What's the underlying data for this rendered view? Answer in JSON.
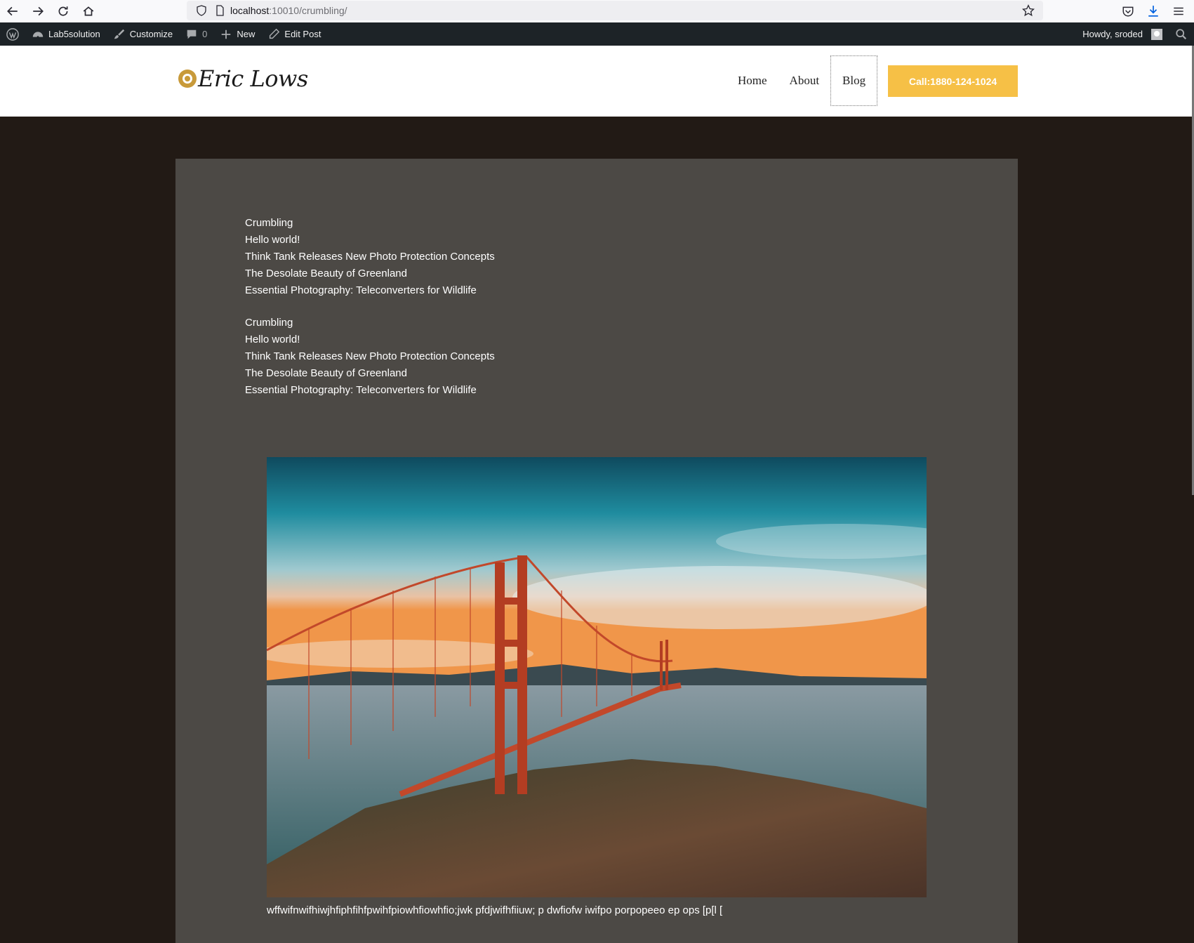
{
  "browser": {
    "url_host": "localhost",
    "url_path": ":10010/crumbling/"
  },
  "adminbar": {
    "site_name": "Lab5solution",
    "customize": "Customize",
    "comments_count": "0",
    "new_label": "New",
    "edit_post": "Edit Post",
    "howdy": "Howdy, sroded"
  },
  "header": {
    "logo_text": "Eric Lows",
    "nav": [
      "Home",
      "About",
      "Blog"
    ],
    "cta": "Call:1880-124-1024"
  },
  "recent_posts_1": [
    "Crumbling",
    "Hello world!",
    "Think Tank Releases New Photo Protection Concepts",
    "The Desolate Beauty of Greenland",
    "Essential Photography: Teleconverters for Wildlife"
  ],
  "recent_posts_2": [
    "Crumbling",
    "Hello world!",
    "Think Tank Releases New Photo Protection Concepts",
    "The Desolate Beauty of Greenland",
    "Essential Photography: Teleconverters for Wildlife"
  ],
  "post": {
    "caption": "wffwifnwifhiwjhfiphfihfpwihfpiowhfiowhfio;jwk pfdjwifhfiiuw; p dwfiofw iwifpo porpopeeo ep ops [p[l ["
  },
  "colors": {
    "admin_bar": "#1d2327",
    "page_bg": "#221a15",
    "content_bg": "#4c4945",
    "accent": "#f6c046"
  }
}
